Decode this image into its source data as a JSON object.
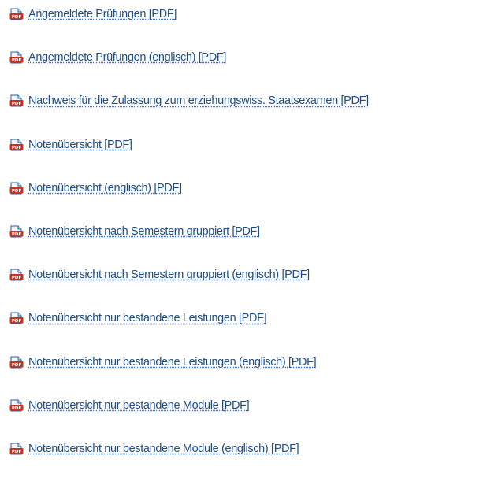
{
  "documents": {
    "icon": "pdf-file-icon",
    "colors": {
      "link": "#1d4d85",
      "icon_red": "#c8321e",
      "icon_blue": "#2a5ea8"
    },
    "items": [
      {
        "label": "Angemeldete Prüfungen [PDF]"
      },
      {
        "label": "Angemeldete Prüfungen (englisch) [PDF]"
      },
      {
        "label": "Nachweis für die Zulassung zum erziehungswiss. Staatsexamen [PDF]"
      },
      {
        "label": "Notenübersicht [PDF]"
      },
      {
        "label": "Notenübersicht (englisch) [PDF]"
      },
      {
        "label": "Notenübersicht nach Semestern gruppiert [PDF]"
      },
      {
        "label": "Notenübersicht nach Semestern gruppiert (englisch) [PDF]"
      },
      {
        "label": "Notenübersicht nur bestandene Leistungen [PDF]"
      },
      {
        "label": "Notenübersicht nur bestandene Leistungen (englisch) [PDF]"
      },
      {
        "label": "Notenübersicht nur bestandene Module [PDF]"
      },
      {
        "label": "Notenübersicht nur bestandene Module (englisch) [PDF]"
      }
    ]
  }
}
